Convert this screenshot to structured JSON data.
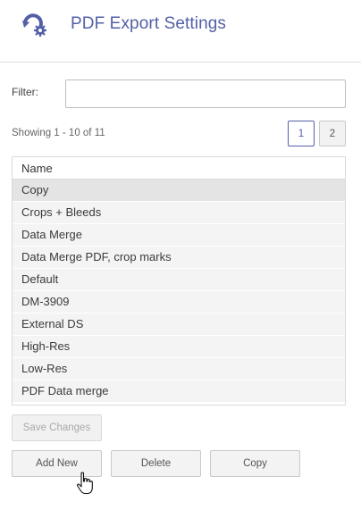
{
  "header": {
    "title": "PDF Export Settings",
    "icon": "pdf-export-settings-icon"
  },
  "filter": {
    "label": "Filter:",
    "value": "",
    "placeholder": ""
  },
  "pagination": {
    "showing_text": "Showing 1 - 10 of 11",
    "pages": [
      "1",
      "2"
    ],
    "current_page": "1"
  },
  "table": {
    "column_header": "Name",
    "rows": [
      "Copy",
      "Crops + Bleeds",
      "Data Merge",
      "Data Merge PDF, crop marks",
      "Default",
      "DM-3909",
      "External DS",
      "High-Res",
      "Low-Res",
      "PDF Data merge"
    ],
    "selected_row": "Copy"
  },
  "actions": {
    "save_changes": "Save Changes",
    "add_new": "Add New",
    "delete": "Delete",
    "copy": "Copy"
  },
  "colors": {
    "accent": "#5360a8",
    "row_bg": "#f4f4f4",
    "selected_row_bg": "#e4e4e4"
  }
}
